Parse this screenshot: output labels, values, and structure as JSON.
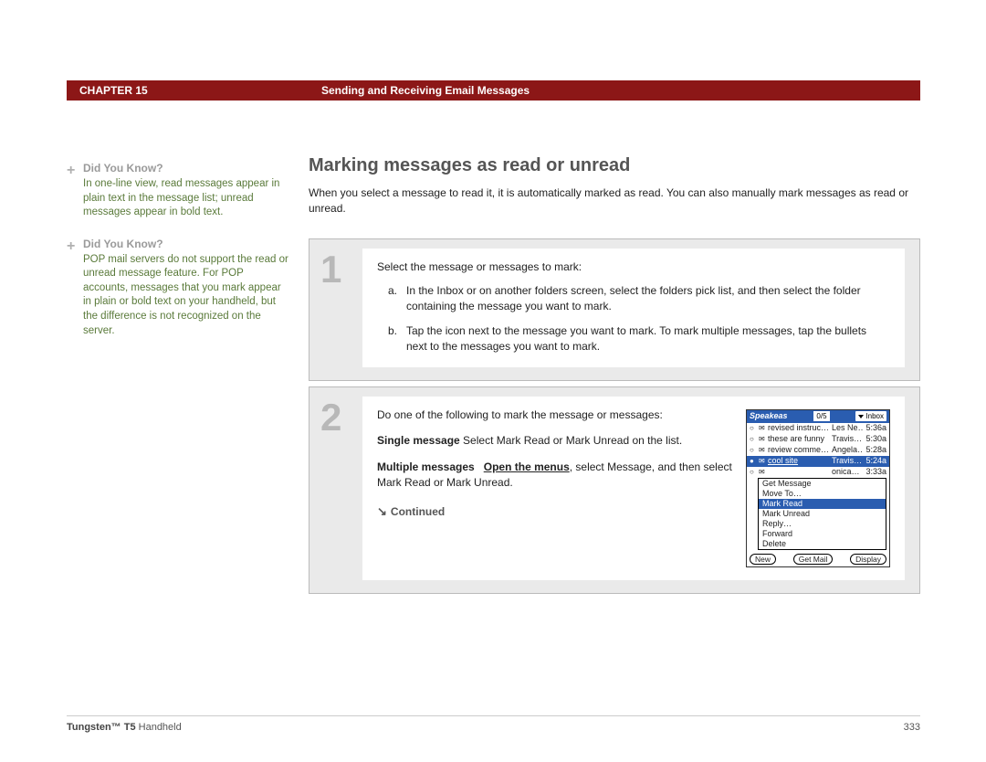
{
  "header": {
    "chapter": "CHAPTER 15",
    "title": "Sending and Receiving Email Messages"
  },
  "section": {
    "title": "Marking messages as read or unread",
    "intro": "When you select a message to read it, it is automatically marked as read. You can also manually mark messages as read or unread."
  },
  "sidebar": [
    {
      "heading": "Did You Know?",
      "body": "In one-line view, read messages appear in plain text in the message list; unread messages appear in bold text."
    },
    {
      "heading": "Did You Know?",
      "body": "POP mail servers do not support the read or unread message feature. For POP accounts, messages that you mark appear in plain or bold text on your handheld, but the difference is not recognized on the server."
    }
  ],
  "steps": {
    "step1": {
      "num": "1",
      "lead": "Select the message or messages to mark:",
      "a_letter": "a.",
      "a_text": "In the Inbox or on another folders screen, select the folders pick list, and then select the folder containing the message you want to mark.",
      "b_letter": "b.",
      "b_text": "Tap the icon next to the message you want to mark. To mark multiple messages, tap the bullets next to the messages you want to mark."
    },
    "step2": {
      "num": "2",
      "lead": "Do one of the following to mark the message or messages:",
      "single_label": "Single message",
      "single_rest": "  Select Mark Read or Mark Unread on the list.",
      "multi_label": "Multiple messages",
      "multi_link": "Open the menus",
      "multi_rest": ", select Message, and then select Mark Read or Mark Unread.",
      "continued": "Continued"
    }
  },
  "device": {
    "title": "Speakeas",
    "count": "0/5",
    "inbox": "Inbox",
    "rows": [
      {
        "dot": "○",
        "env": "✉",
        "subj": "revised instruc…",
        "from": "Les Ne…",
        "time": "5:36a"
      },
      {
        "dot": "○",
        "env": "✉",
        "subj": "these are funny",
        "from": "Travis…",
        "time": "5:30a"
      },
      {
        "dot": "○",
        "env": "✉",
        "subj": "review comme…",
        "from": "Angela…",
        "time": "5:28a"
      },
      {
        "dot": "●",
        "env": "✉",
        "subj": "cool site",
        "from": "Travis…",
        "time": "5:24a",
        "sel": true
      },
      {
        "dot": "○",
        "env": "✉",
        "subj": "",
        "from": "onica…",
        "time": "3:33a"
      }
    ],
    "menu": [
      "Get Message",
      "Move To…",
      "Mark Read",
      "Mark Unread",
      "Reply…",
      "Forward",
      "Delete"
    ],
    "menu_sel": "Mark Read",
    "buttons": {
      "new": "New",
      "get": "Get Mail",
      "display": "Display"
    }
  },
  "footer": {
    "product_bold": "Tungsten™ T5",
    "product_rest": " Handheld",
    "page": "333"
  }
}
